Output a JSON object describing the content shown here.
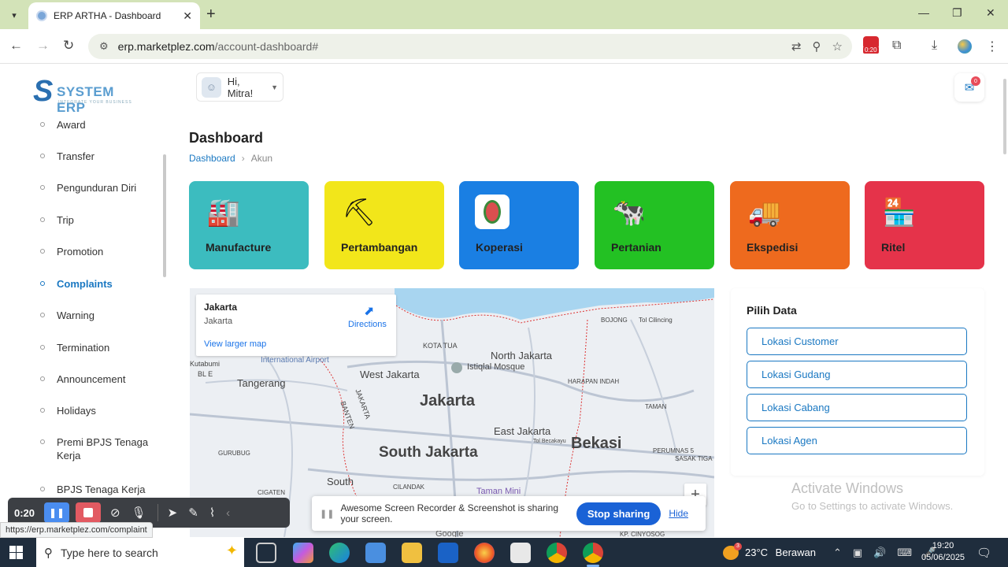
{
  "browser": {
    "tab_title": "ERP ARTHA - Dashboard",
    "url_host": "erp.marketplez.com",
    "url_path": "/account-dashboard#",
    "recorder_badge_time": "0:20"
  },
  "logo": {
    "word": "SYSTEM ERP",
    "tagline": "INTEGRATE YOUR BUSINESS"
  },
  "sidebar": {
    "items": [
      {
        "label": "Award"
      },
      {
        "label": "Transfer"
      },
      {
        "label": "Pengunduran Diri"
      },
      {
        "label": "Trip"
      },
      {
        "label": "Promotion"
      },
      {
        "label": "Complaints"
      },
      {
        "label": "Warning"
      },
      {
        "label": "Termination"
      },
      {
        "label": "Announcement"
      },
      {
        "label": "Holidays"
      },
      {
        "label": "Premi BPJS Tenaga Kerja"
      },
      {
        "label": "BPJS Tenaga Kerja"
      }
    ]
  },
  "header": {
    "greeting": "Hi, Mitra!",
    "notification_count": "0"
  },
  "page": {
    "title": "Dashboard",
    "breadcrumb": {
      "link": "Dashboard",
      "current": "Akun"
    }
  },
  "cards": [
    {
      "label": "Manufacture",
      "color": "#3cbcbf",
      "icon": "factory-icon"
    },
    {
      "label": "Pertambangan",
      "color": "#f2e61a",
      "icon": "mining-icon"
    },
    {
      "label": "Koperasi",
      "color": "#1a7fe3",
      "icon": "koperasi-logo"
    },
    {
      "label": "Pertanian",
      "color": "#23c123",
      "icon": "cow-icon"
    },
    {
      "label": "Ekspedisi",
      "color": "#ee6a1e",
      "icon": "truck-icon"
    },
    {
      "label": "Ritel",
      "color": "#e5334a",
      "icon": "store-icon"
    }
  ],
  "map": {
    "place_name": "Jakarta",
    "place_sub": "Jakarta",
    "directions": "Directions",
    "view_larger": "View larger map",
    "labels": {
      "kota_tua": "KOTA TUA",
      "north_jakarta": "North Jakarta",
      "istiqlal": "Istiqlal Mosque",
      "bojong": "BOJONG",
      "tol_cilincing": "Tol Cilincing",
      "kutabumi": "Kutabumi",
      "international_airport": "International Airport",
      "bl_e": "BL E",
      "west_jakarta": "West Jakarta",
      "tangerang": "Tangerang",
      "jakarta": "Jakarta",
      "harapan_indah": "HARAPAN INDAH",
      "taman": "TAMAN",
      "banten": "BANTEN",
      "jakarta_border": "JAKARTA",
      "east_jakarta": "East Jakarta",
      "bekasi": "Bekasi",
      "south_jakarta": "South Jakarta",
      "gurubug": "GURUBUG",
      "tol_becakayu": "Tol Becakayu",
      "perumnas": "PERUMNAS 5",
      "sasak": "SASAK TIGA",
      "cigaten": "CIGATEN",
      "south": "South",
      "cilandak": "CILANDAK",
      "taman_mini": "Taman Mini",
      "kp_cinyosog": "KP. CINYOSOG",
      "google": "Google",
      "zoom_in": "+"
    }
  },
  "pilih_data": {
    "title": "Pilih Data",
    "options": [
      "Lokasi Customer",
      "Lokasi Gudang",
      "Lokasi Cabang",
      "Lokasi Agen"
    ]
  },
  "watermark": {
    "line1": "Activate Windows",
    "line2": "Go to Settings to activate Windows."
  },
  "recorder": {
    "time": "0:20",
    "share_message": "Awesome Screen Recorder & Screenshot is sharing your screen.",
    "stop_sharing": "Stop sharing",
    "hide": "Hide"
  },
  "status_url": "https://erp.marketplez.com/complaint",
  "taskbar": {
    "search_placeholder": "Type here to search",
    "weather_temp": "23°C",
    "weather_text": "Berawan",
    "weather_badge": "3",
    "time": "19:20",
    "date": "05/06/2025",
    "notification_count": "1"
  }
}
